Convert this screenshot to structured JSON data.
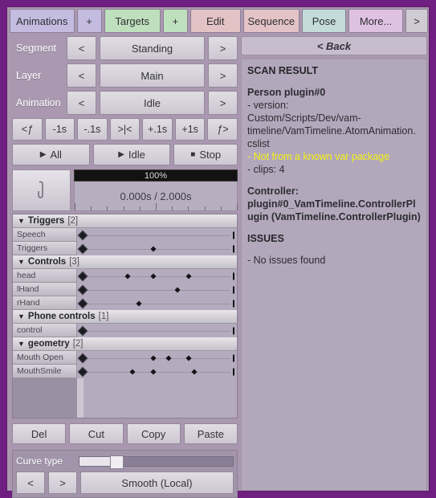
{
  "toolbar": {
    "buttons": [
      {
        "label": "Animations",
        "style": "tb-lav"
      },
      {
        "label": "+",
        "style": "tb-lav"
      },
      {
        "label": "Targets",
        "style": "tb-grn"
      },
      {
        "label": "+",
        "style": "tb-grn"
      },
      {
        "label": "Edit",
        "style": "tb-pnk"
      },
      {
        "label": "Sequence",
        "style": "tb-pnk"
      },
      {
        "label": "Pose",
        "style": "tb-tel"
      },
      {
        "label": "More...",
        "style": "tb-vio"
      },
      {
        "label": ">",
        "style": "tb-gry"
      }
    ]
  },
  "selectors": [
    {
      "label": "Segment",
      "prev": "<",
      "value": "Standing",
      "next": ">"
    },
    {
      "label": "Layer",
      "prev": "<",
      "value": "Main",
      "next": ">"
    },
    {
      "label": "Animation",
      "prev": "<",
      "value": "Idle",
      "next": ">"
    }
  ],
  "nav": {
    "buttons": [
      "<ƒ",
      "-1s",
      "-.1s",
      ">|<",
      "+.1s",
      "+1s",
      "ƒ>"
    ]
  },
  "playback": {
    "play_all": "All",
    "play_clip": "Idle",
    "stop": "Stop"
  },
  "scrubber": {
    "progress_label": "100%",
    "progress_percent": 100,
    "time_label": "0.000s / 2.000s",
    "current_time": "0.000s",
    "total_time": "2.000s",
    "curve_icon": "curve-icon"
  },
  "targets": {
    "groups": [
      {
        "name": "Triggers",
        "count": "[2]",
        "rows": [
          {
            "name": "Speech",
            "keyframes": [
              0,
              100
            ],
            "ends": [
              100
            ]
          },
          {
            "name": "Triggers",
            "keyframes": [
              0,
              47,
              100
            ],
            "ends": [
              100
            ]
          }
        ]
      },
      {
        "name": "Controls",
        "count": "[3]",
        "rows": [
          {
            "name": "head",
            "keyframes": [
              0,
              30,
              47,
              70,
              100
            ],
            "ends": [
              100
            ]
          },
          {
            "name": "lHand",
            "keyframes": [
              0,
              63,
              100
            ],
            "ends": [
              100
            ]
          },
          {
            "name": "rHand",
            "keyframes": [
              0,
              37,
              100
            ],
            "ends": [
              100
            ]
          }
        ]
      },
      {
        "name": "Phone controls",
        "count": "[1]",
        "rows": [
          {
            "name": "control",
            "keyframes": [
              0,
              100
            ],
            "ends": [
              100
            ]
          }
        ]
      },
      {
        "name": "geometry",
        "count": "[2]",
        "rows": [
          {
            "name": "Mouth Open",
            "keyframes": [
              0,
              47,
              57,
              70,
              100
            ],
            "ends": [
              100
            ]
          },
          {
            "name": "MouthSmile",
            "keyframes": [
              0,
              33,
              47,
              74,
              100
            ],
            "ends": [
              100
            ]
          }
        ]
      }
    ]
  },
  "edit_actions": [
    "Del",
    "Cut",
    "Copy",
    "Paste"
  ],
  "curve": {
    "label": "Curve type",
    "slider_percent": 22,
    "prev": "<",
    "next": ">",
    "value": "Smooth (Local)"
  },
  "right_panel": {
    "back_label": "< Back",
    "lines": [
      {
        "text": "SCAN RESULT",
        "kind": "head"
      },
      {
        "text": "",
        "kind": "blank"
      },
      {
        "text": "Person plugin#0",
        "kind": "bold"
      },
      {
        "text": "- version:",
        "kind": "plain"
      },
      {
        "text": "Custom/Scripts/Dev/vam-timeline/VamTimeline.AtomAnimation.cslist",
        "kind": "plain"
      },
      {
        "text": "- Not from a known var package",
        "kind": "warn"
      },
      {
        "text": "- clips: 4",
        "kind": "plain"
      },
      {
        "text": "",
        "kind": "blank"
      },
      {
        "text": "Controller: plugin#0_VamTimeline.ControllerPlugin (VamTimeline.ControllerPlugin)",
        "kind": "bold"
      },
      {
        "text": "",
        "kind": "blank"
      },
      {
        "text": "ISSUES",
        "kind": "head"
      },
      {
        "text": "",
        "kind": "blank"
      },
      {
        "text": "- No issues found",
        "kind": "plain"
      }
    ]
  },
  "colors": {
    "window_border": "#6f1f80",
    "panel_bg": "#a998b0",
    "lane_bg": "#b5abbe",
    "warning": "#f2f214",
    "progress_bar": "#121212"
  }
}
